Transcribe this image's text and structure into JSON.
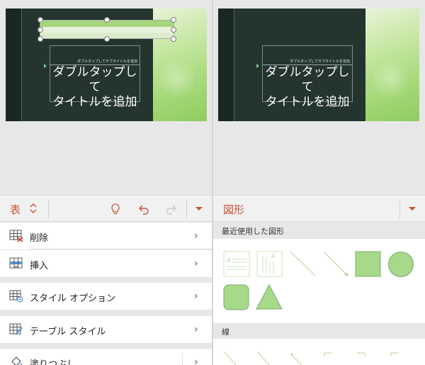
{
  "slide": {
    "subtitle_placeholder": "ダブルタップしてサブタイトルを追加",
    "title_placeholder_line1": "ダブルタップして",
    "title_placeholder_line2": "タイトルを追加"
  },
  "left_panel": {
    "toolbar": {
      "label": "表"
    },
    "menu": [
      {
        "label": "削除",
        "icon": "table-delete-icon"
      },
      {
        "label": "挿入",
        "icon": "table-insert-icon"
      },
      {
        "label": "スタイル オプション",
        "icon": "table-style-options-icon"
      },
      {
        "label": "テーブル スタイル",
        "icon": "table-style-icon"
      },
      {
        "label": "塗りつぶし",
        "icon": "paint-bucket-icon"
      }
    ]
  },
  "right_panel": {
    "toolbar": {
      "label": "図形"
    },
    "recent_header": "最近使用した図形",
    "lines_header": "線"
  },
  "colors": {
    "accent": "#c9523a",
    "shape_fill": "#a6d98a",
    "shape_stroke": "#7aaa6a"
  }
}
